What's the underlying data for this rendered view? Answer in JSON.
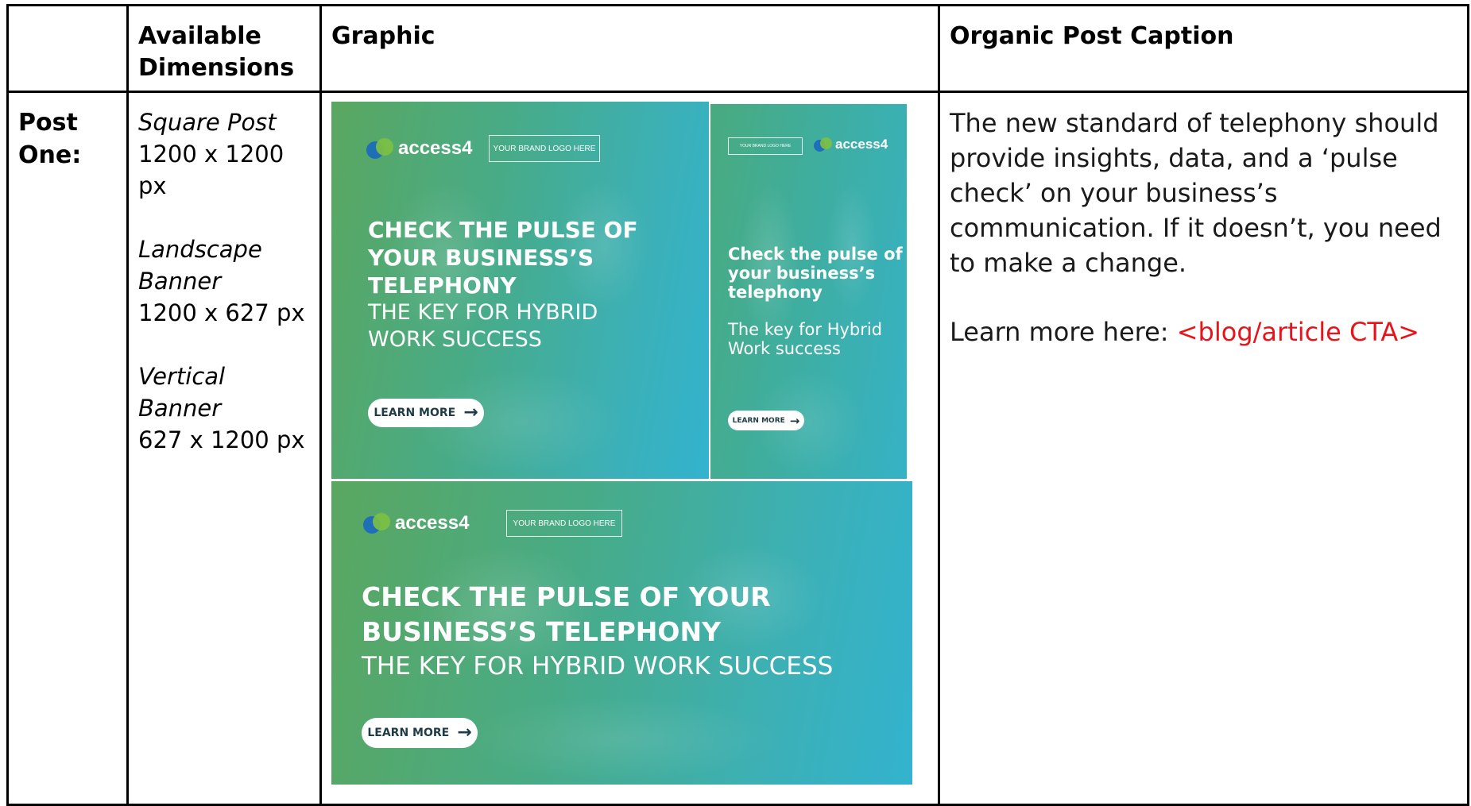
{
  "table": {
    "headers": [
      "",
      "Available Dimensions",
      "Graphic",
      "Organic Post Caption"
    ],
    "header_line1": "Available",
    "header_line2": "Dimensions"
  },
  "row": {
    "label_line1": "Post",
    "label_line2": "One:",
    "dimensions": {
      "square_label": "Square Post",
      "square_size": "1200 x 1200 px",
      "landscape_label_line1": "Landscape",
      "landscape_label_line2": "Banner",
      "landscape_size": "1200 x 627 px",
      "vertical_label": "Vertical Banner",
      "vertical_size": "627 x 1200 px"
    },
    "caption": {
      "paragraph": "The new standard of telephony should provide insights, data, and a ‘pulse check’ on your business’s communication. If it doesn’t, you need to make a change.",
      "learn_prefix": "Learn more here: ",
      "cta": "<blog/article CTA>"
    }
  },
  "graphics": {
    "logo_text": "access4",
    "brand_box": "YOUR BRAND LOGO HERE",
    "square": {
      "head_line1": "CHECK THE PULSE OF",
      "head_line2": "YOUR BUSINESS’S",
      "head_line3": "TELEPHONY",
      "sub_line1": "THE KEY FOR HYBRID",
      "sub_line2": "WORK SUCCESS",
      "button": "LEARN MORE"
    },
    "vertical": {
      "head_line1": "Check the pulse of",
      "head_line2": "your business’s",
      "head_line3": "telephony",
      "sub_line1": "The key for Hybrid",
      "sub_line2": "Work success",
      "button": "LEARN MORE"
    },
    "landscape": {
      "head_line1": "CHECK THE PULSE OF YOUR",
      "head_line2": "BUSINESS’S TELEPHONY",
      "sub_line1": "THE KEY FOR HYBRID WORK SUCCESS",
      "button": "LEARN MORE"
    }
  },
  "colors": {
    "cta_red": "#e8141b",
    "gradient_green": "#5aa760",
    "gradient_teal": "#33b3cf",
    "logo_blue": "#1e6fb8",
    "logo_green": "#7dc142"
  },
  "icons": [
    "access4-logo-mark",
    "arrow-right-icon"
  ]
}
